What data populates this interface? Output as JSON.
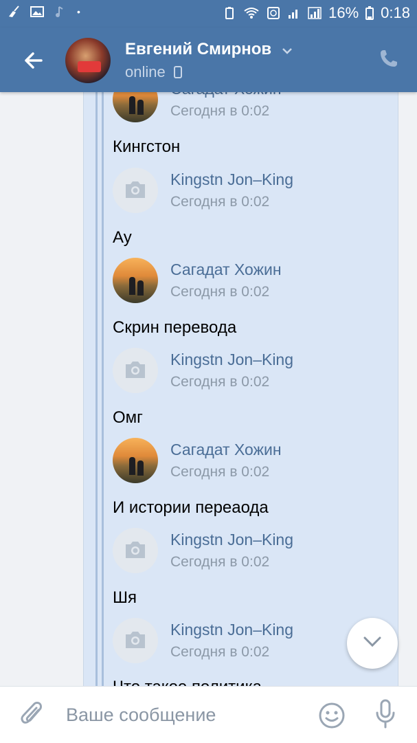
{
  "status_bar": {
    "battery_percent": "16%",
    "time": "0:18"
  },
  "header": {
    "contact_name": "Евгений Смирнов",
    "status": "online"
  },
  "messages": [
    {
      "author": "Сагадат Хожин",
      "time": "Сегодня в 0:02",
      "text": "Кингстон",
      "avatar": "photo"
    },
    {
      "author": "Kingstn Jon–King",
      "time": "Сегодня в 0:02",
      "text": "Ау",
      "avatar": "camera-placeholder"
    },
    {
      "author": "Сагадат Хожин",
      "time": "Сегодня в 0:02",
      "text": "Скрин перевода",
      "avatar": "photo"
    },
    {
      "author": "Kingstn Jon–King",
      "time": "Сегодня в 0:02",
      "text": "Омг",
      "avatar": "camera-placeholder"
    },
    {
      "author": "Сагадат Хожин",
      "time": "Сегодня в 0:02",
      "text": "И истории переаода",
      "avatar": "photo"
    },
    {
      "author": "Kingstn Jon–King",
      "time": "Сегодня в 0:02",
      "text": "Шя",
      "avatar": "camera-placeholder"
    },
    {
      "author": "Kingstn Jon–King",
      "time": "Сегодня в 0:02",
      "text": "Что такое политика",
      "avatar": "camera-placeholder"
    }
  ],
  "composer": {
    "placeholder": "Ваше сообщение"
  },
  "colors": {
    "header_bg": "#4a76a8",
    "bubble_bg": "#dae6f6",
    "author_link": "#4a6d96"
  }
}
